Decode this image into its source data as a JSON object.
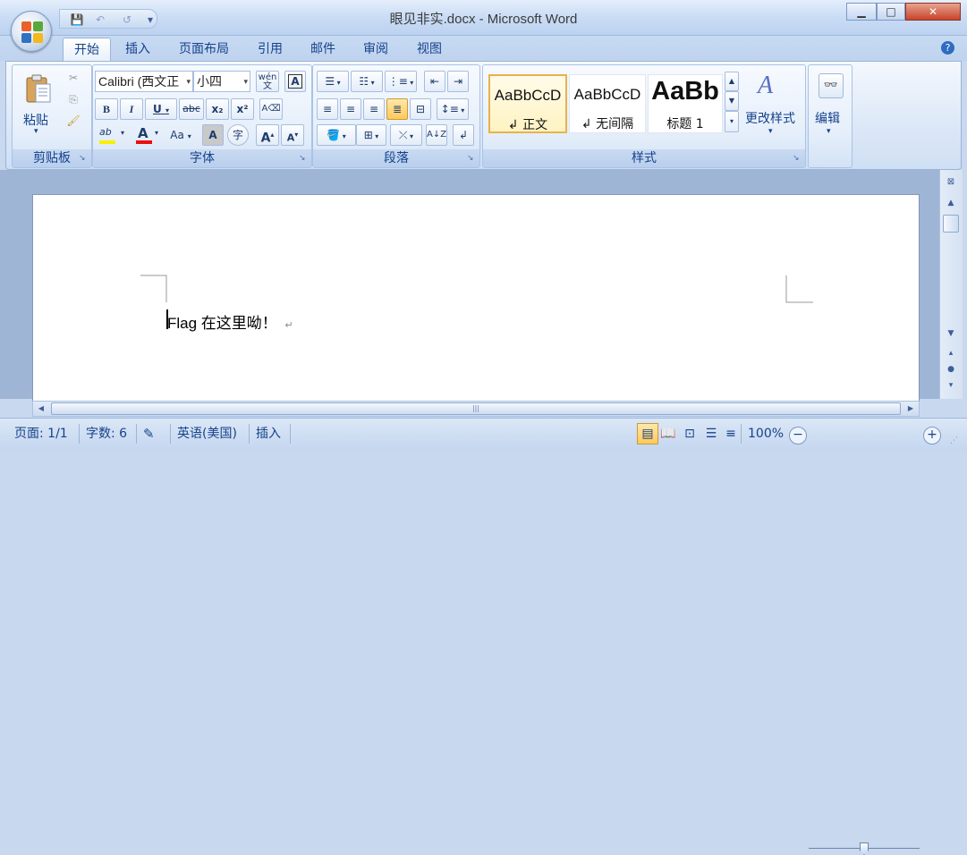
{
  "window": {
    "title": "眼见非实.docx - Microsoft Word",
    "minimize": "▁",
    "maximize": "□",
    "close": "✕"
  },
  "qat": {
    "save": "💾",
    "undo": "↶",
    "redo": "↺",
    "more": "▾"
  },
  "tabs": [
    {
      "label": "开始",
      "active": true
    },
    {
      "label": "插入"
    },
    {
      "label": "页面布局"
    },
    {
      "label": "引用"
    },
    {
      "label": "邮件"
    },
    {
      "label": "审阅"
    },
    {
      "label": "视图"
    }
  ],
  "help": "?",
  "clipboard": {
    "paste_label": "粘贴",
    "group_label": "剪贴板"
  },
  "font": {
    "name": "Calibri (西文正",
    "size": "小四",
    "group_label": "字体",
    "bold": "B",
    "italic": "I",
    "underline": "U",
    "strike": "abc",
    "subscript": "x₂",
    "superscript": "x²",
    "highlight": "ab",
    "fontcolor": "A",
    "changecase": "Aa",
    "grow": "A",
    "shrink": "A",
    "phonetic": "wén\n文",
    "charborder": "A",
    "enclose": "字"
  },
  "paragraph": {
    "group_label": "段落"
  },
  "styles": {
    "group_label": "样式",
    "items": [
      {
        "sample": "AaBbCcD",
        "name": "↲ 正文"
      },
      {
        "sample": "AaBbCcD",
        "name": "↲ 无间隔"
      },
      {
        "sample": "AaBb",
        "name": "标题 1"
      }
    ],
    "change_label": "更改样式"
  },
  "editing": {
    "label": "编辑"
  },
  "document": {
    "text": "Flag 在这里呦！",
    "pilcrow": "↵"
  },
  "status": {
    "page": "页面: 1/1",
    "words": "字数: 6",
    "language": "英语(美国)",
    "mode": "插入",
    "zoom": "100%"
  }
}
